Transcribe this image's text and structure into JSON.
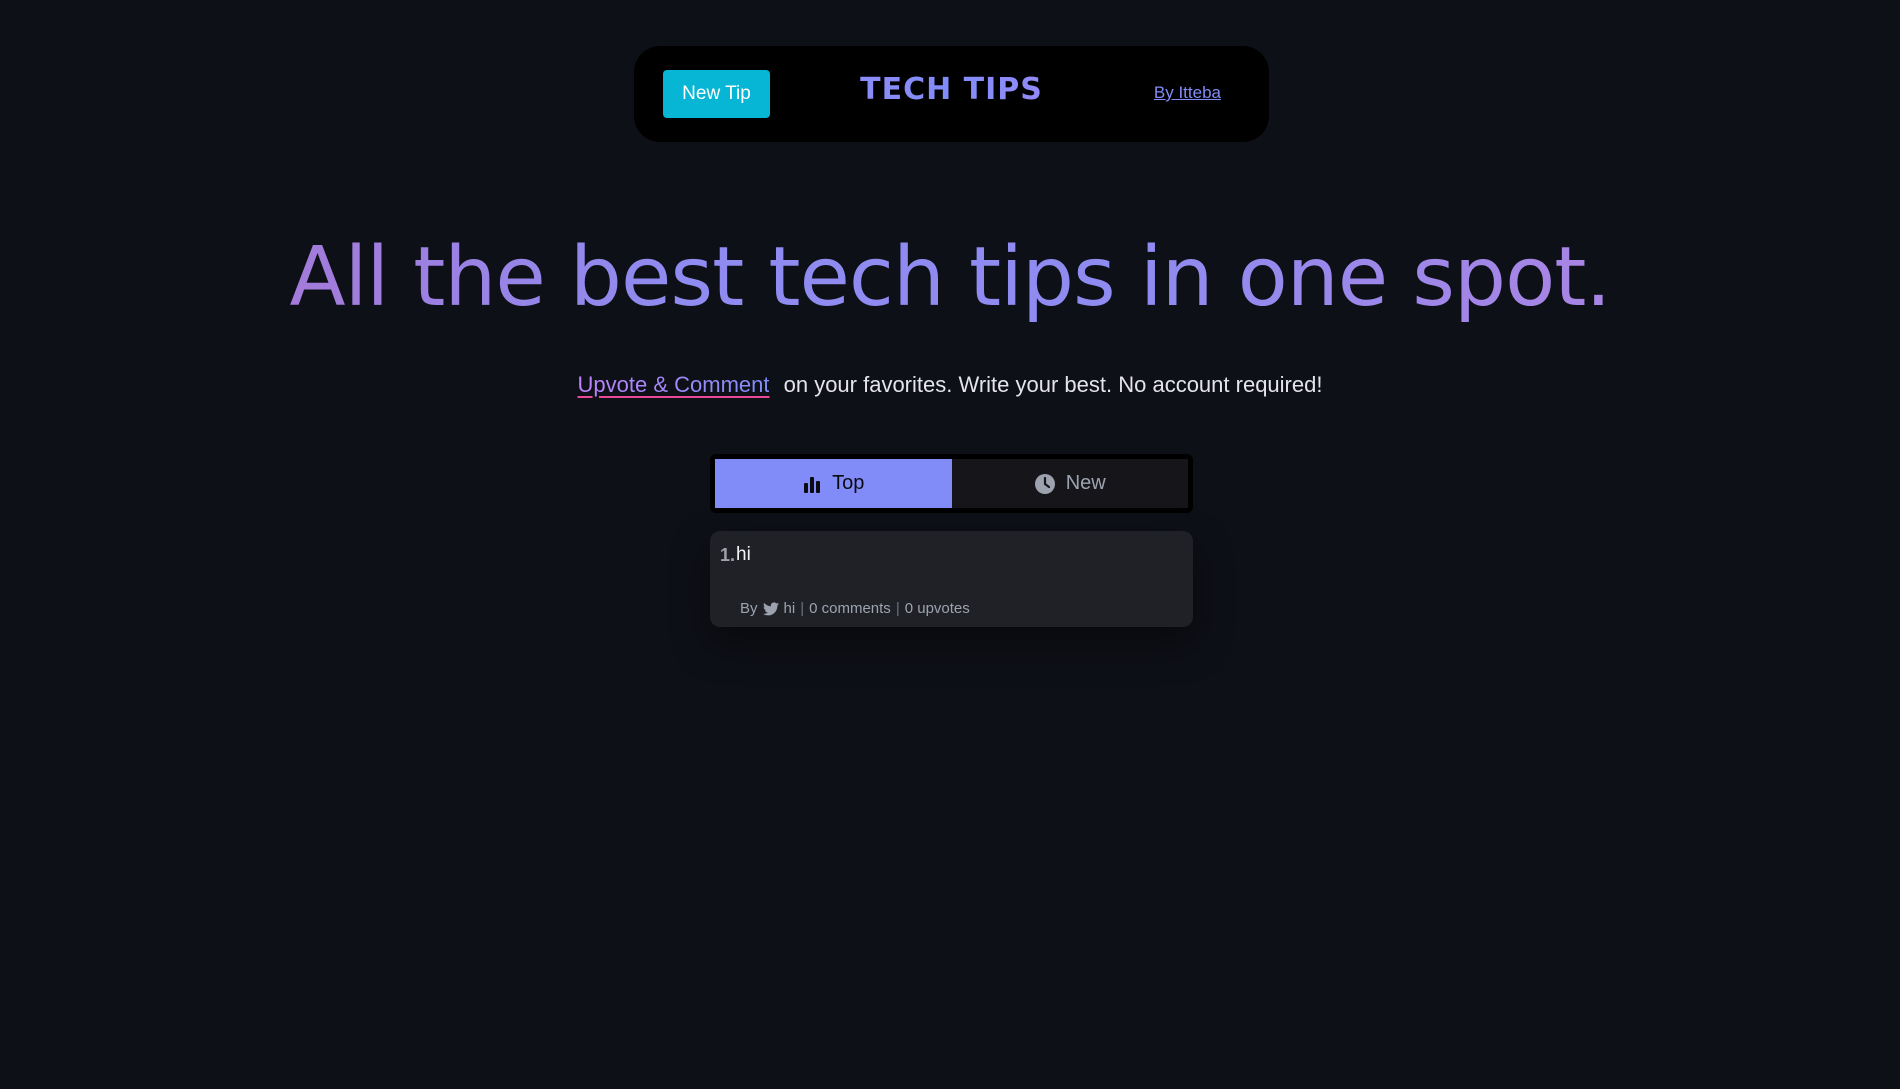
{
  "header": {
    "new_tip_label": "New Tip",
    "brand": "TECH TIPS",
    "author_link": "By Itteba"
  },
  "hero": {
    "title": "All the best tech tips in one spot.",
    "cta_link": "Upvote & Comment",
    "subtitle_rest": "on your favorites. Write your best. No account required!"
  },
  "tabs": [
    {
      "label": "Top",
      "icon": "bar-chart-icon",
      "active": true
    },
    {
      "label": "New",
      "icon": "clock-icon",
      "active": false
    }
  ],
  "tips": [
    {
      "rank": "1.",
      "title": "hi",
      "by_label": "By",
      "author_icon": "twitter-icon",
      "author": "hi",
      "separator": "|",
      "comments": "0 comments",
      "upvotes": "0 upvotes"
    }
  ],
  "colors": {
    "background": "#0e1017",
    "accent_cyan": "#06b6d4",
    "accent_indigo": "#818cf8",
    "accent_purple": "#a78bfa",
    "card": "#202126"
  }
}
